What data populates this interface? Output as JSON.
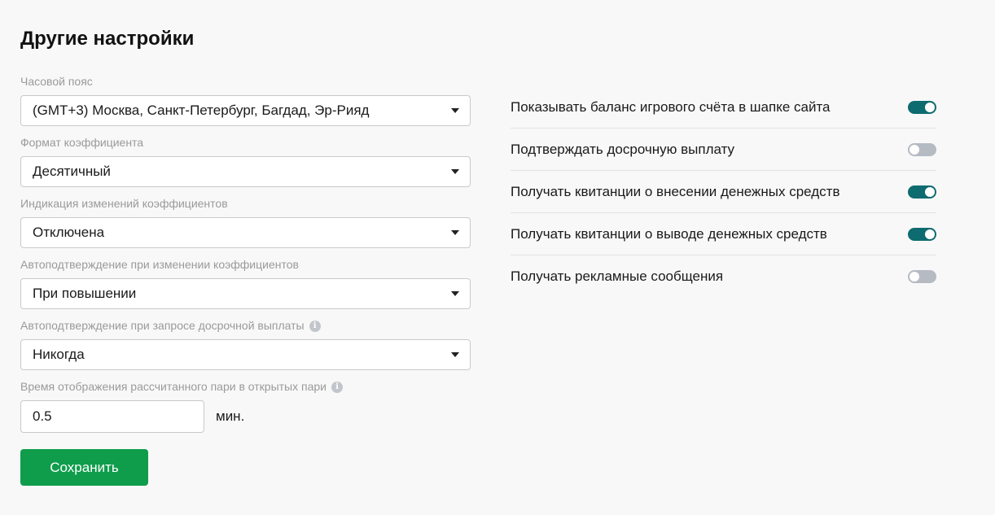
{
  "page": {
    "title": "Другие настройки"
  },
  "settings": {
    "timezone": {
      "label": "Часовой пояс",
      "value": "(GMT+3) Москва, Санкт-Петербург, Багдад, Эр-Рияд"
    },
    "odds_format": {
      "label": "Формат коэффициента",
      "value": "Десятичный"
    },
    "odds_change_indication": {
      "label": "Индикация изменений коэффициентов",
      "value": "Отключена"
    },
    "auto_confirm_odds_change": {
      "label": "Автоподтверждение при изменении коэффициентов",
      "value": "При повышении"
    },
    "auto_confirm_cashout": {
      "label": "Автоподтверждение при запросе досрочной выплаты",
      "value": "Никогда",
      "info_icon": "info-icon"
    },
    "settled_bet_display_time": {
      "label": "Время отображения рассчитанного пари в открытых пари",
      "value": "0.5",
      "unit": "мин.",
      "info_icon": "info-icon"
    }
  },
  "save_button": {
    "label": "Сохранить",
    "color": "#0f9d4c"
  },
  "toggles": [
    {
      "label": "Показывать баланс игрового счёта в шапке сайта",
      "enabled": true
    },
    {
      "label": "Подтверждать досрочную выплату",
      "enabled": false
    },
    {
      "label": "Получать квитанции о внесении денежных средств",
      "enabled": true
    },
    {
      "label": "Получать квитанции о выводе денежных средств",
      "enabled": true
    },
    {
      "label": "Получать рекламные сообщения",
      "enabled": false
    }
  ],
  "colors": {
    "toggle_on": "#0e6b6f",
    "toggle_off": "#b5bac3",
    "label_gray": "#9a9a9a"
  }
}
